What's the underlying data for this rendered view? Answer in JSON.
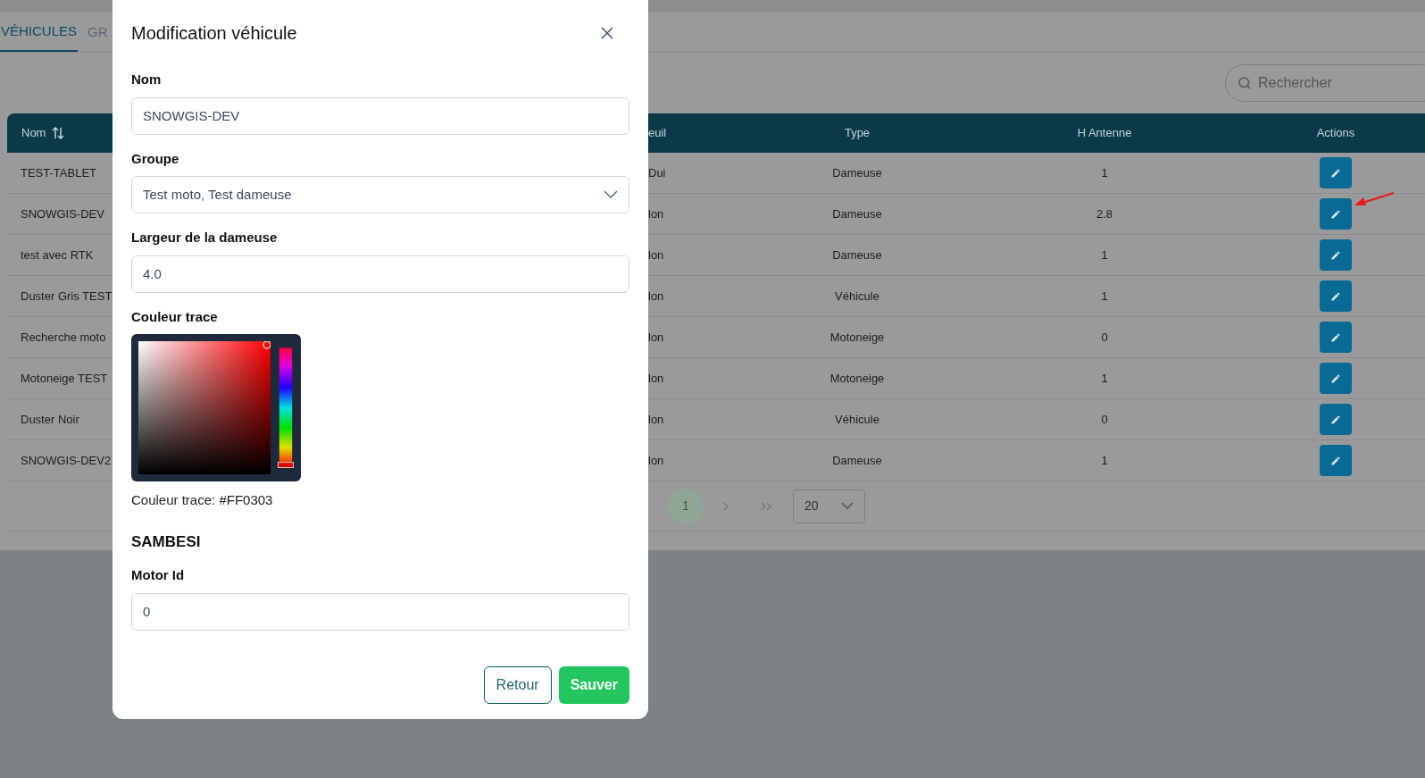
{
  "tabs": [
    {
      "label": "VÉHICULES",
      "selected": true
    },
    {
      "label": "GR",
      "selected": false
    }
  ],
  "search": {
    "placeholder": "Rechercher"
  },
  "table": {
    "columns": [
      "Nom",
      "euil",
      "Type",
      "H Antenne",
      "Actions"
    ],
    "rows": [
      {
        "name": "TEST-TABLET",
        "column_2": "Dui",
        "type": "Dameuse",
        "h_antenne": "1"
      },
      {
        "name": "SNOWGIS-DEV",
        "column_2": "lon",
        "type": "Dameuse",
        "h_antenne": "2.8"
      },
      {
        "name": "test avec RTK",
        "column_2": "lon",
        "type": "Dameuse",
        "h_antenne": "1"
      },
      {
        "name": "Duster Gris TEST",
        "column_2": "lon",
        "type": "Véhicule",
        "h_antenne": "1"
      },
      {
        "name": "Recherche moto",
        "column_2": "lon",
        "type": "Motoneige",
        "h_antenne": "0"
      },
      {
        "name": "Motoneige TEST",
        "column_2": "lon",
        "type": "Motoneige",
        "h_antenne": "1"
      },
      {
        "name": "Duster Noir",
        "column_2": "lon",
        "type": "Véhicule",
        "h_antenne": "0"
      },
      {
        "name": "SNOWGIS-DEV2",
        "column_2": "lon",
        "type": "Dameuse",
        "h_antenne": "1"
      }
    ]
  },
  "pagination": {
    "pages": [
      {
        "label": "1",
        "selected": true
      }
    ],
    "per_page": "20"
  },
  "modal": {
    "title": "Modification véhicule",
    "fields": [
      {
        "kind": "text",
        "label": "Nom",
        "value": "SNOWGIS-DEV"
      },
      {
        "kind": "select",
        "label": "Groupe",
        "value": "Test moto, Test dameuse"
      },
      {
        "kind": "text",
        "label": "Largeur de la dameuse",
        "value": "4.0"
      },
      {
        "kind": "color",
        "label": "Couleur trace",
        "caption": "Couleur trace: #FF0303",
        "level": 0
      },
      {
        "kind": "heading",
        "label": "SAMBESI"
      },
      {
        "kind": "text",
        "label": "Motor Id",
        "value": "0"
      }
    ],
    "buttons": [
      {
        "label": "Retour",
        "kind": "secondary"
      },
      {
        "label": "Sauver",
        "kind": "primary"
      }
    ]
  }
}
